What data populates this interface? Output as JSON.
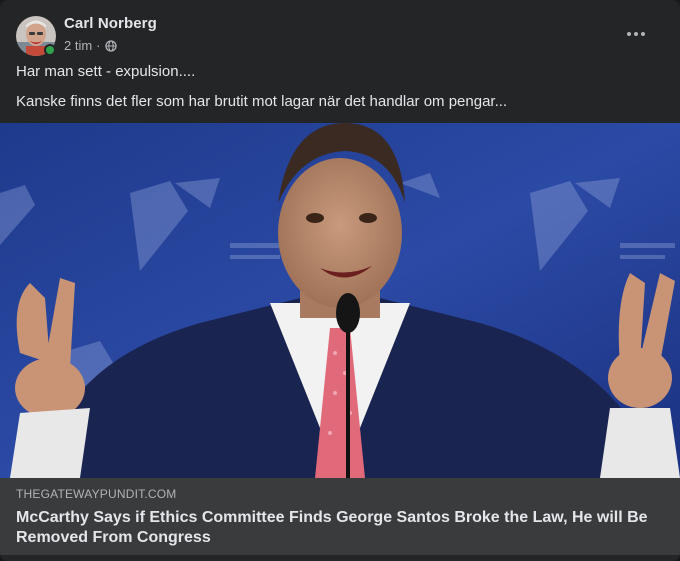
{
  "post": {
    "author": "Carl Norberg",
    "timestamp": "2 tim",
    "separator": "·",
    "audience_icon": "globe-icon",
    "more_icon": "more-options-icon",
    "text_lines": [
      "Har man sett - expulsion....",
      "Kanske finns det fler som har brutit mot lagar när det handlar om pengar..."
    ]
  },
  "link_preview": {
    "domain": "THEGATEWAYPUNDIT.COM",
    "headline": "McCarthy Says if Ethics Committee Finds George Santos Broke the Law, He will Be Removed From Congress"
  },
  "colors": {
    "card_background": "#242526",
    "link_footer_background": "#3a3b3c",
    "primary_text": "#e4e6eb",
    "secondary_text": "#b0b3b8",
    "online_status": "#31a24c"
  }
}
